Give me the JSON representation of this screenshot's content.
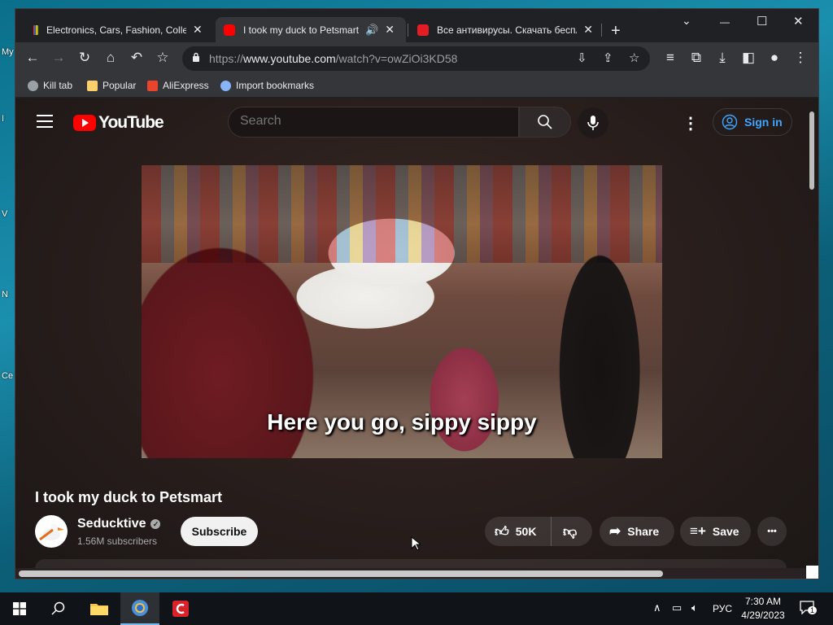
{
  "desktop": {
    "labels": [
      "My",
      "I",
      "V",
      "N",
      "Ce"
    ]
  },
  "browser": {
    "tabs": [
      {
        "title": "Electronics, Cars, Fashion, Collecti",
        "active": false
      },
      {
        "title": "I took my duck to Petsmart",
        "active": true
      },
      {
        "title": "Все антивирусы. Скачать беспл",
        "active": false
      }
    ],
    "new_tab_label": "+",
    "window_controls": {
      "dropdown": "⌄",
      "minimize": "—",
      "maximize": "☐",
      "close": "✕"
    },
    "url_prefix": "https://",
    "url_host": "www.youtube.com",
    "url_path": "/watch?v=owZiOi3KD58",
    "bookmarks": [
      {
        "label": "Kill tab",
        "icon": "globe-icon",
        "color": "#9aa0a6"
      },
      {
        "label": "Popular",
        "icon": "folder-icon",
        "color": "#fbd06b"
      },
      {
        "label": "AliExpress",
        "icon": "aliexpress-icon",
        "color": "#e8452c"
      },
      {
        "label": "Import bookmarks",
        "icon": "gear-icon",
        "color": "#8ab4f8"
      }
    ]
  },
  "youtube": {
    "logo_text": "YouTube",
    "search_placeholder": "Search",
    "sign_in_label": "Sign in",
    "video": {
      "caption": "Here you go, sippy sippy",
      "title": "I took my duck to Petsmart"
    },
    "channel": {
      "name": "Seducktive",
      "verified_mark": "✓",
      "subscribers": "1.56M subscribers"
    },
    "subscribe_label": "Subscribe",
    "like_count": "50K",
    "share_label": "Share",
    "save_label": "Save",
    "more_label": "•••"
  },
  "taskbar": {
    "tray_lang": "РУС",
    "time": "7:30 AM",
    "date": "4/29/2023",
    "notification_count": "1"
  },
  "colors": {
    "accent_blue": "#3ea6ff",
    "youtube_red": "#ff0000",
    "tab_active_bg": "#35363a"
  }
}
